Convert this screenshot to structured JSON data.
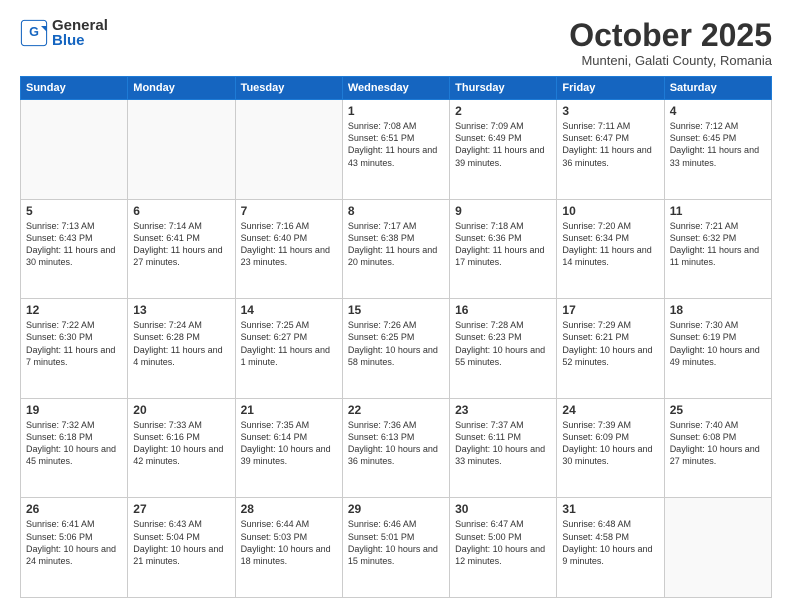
{
  "header": {
    "logo_general": "General",
    "logo_blue": "Blue",
    "month": "October 2025",
    "location": "Munteni, Galati County, Romania"
  },
  "weekdays": [
    "Sunday",
    "Monday",
    "Tuesday",
    "Wednesday",
    "Thursday",
    "Friday",
    "Saturday"
  ],
  "weeks": [
    [
      {
        "day": "",
        "info": ""
      },
      {
        "day": "",
        "info": ""
      },
      {
        "day": "",
        "info": ""
      },
      {
        "day": "1",
        "info": "Sunrise: 7:08 AM\nSunset: 6:51 PM\nDaylight: 11 hours and 43 minutes."
      },
      {
        "day": "2",
        "info": "Sunrise: 7:09 AM\nSunset: 6:49 PM\nDaylight: 11 hours and 39 minutes."
      },
      {
        "day": "3",
        "info": "Sunrise: 7:11 AM\nSunset: 6:47 PM\nDaylight: 11 hours and 36 minutes."
      },
      {
        "day": "4",
        "info": "Sunrise: 7:12 AM\nSunset: 6:45 PM\nDaylight: 11 hours and 33 minutes."
      }
    ],
    [
      {
        "day": "5",
        "info": "Sunrise: 7:13 AM\nSunset: 6:43 PM\nDaylight: 11 hours and 30 minutes."
      },
      {
        "day": "6",
        "info": "Sunrise: 7:14 AM\nSunset: 6:41 PM\nDaylight: 11 hours and 27 minutes."
      },
      {
        "day": "7",
        "info": "Sunrise: 7:16 AM\nSunset: 6:40 PM\nDaylight: 11 hours and 23 minutes."
      },
      {
        "day": "8",
        "info": "Sunrise: 7:17 AM\nSunset: 6:38 PM\nDaylight: 11 hours and 20 minutes."
      },
      {
        "day": "9",
        "info": "Sunrise: 7:18 AM\nSunset: 6:36 PM\nDaylight: 11 hours and 17 minutes."
      },
      {
        "day": "10",
        "info": "Sunrise: 7:20 AM\nSunset: 6:34 PM\nDaylight: 11 hours and 14 minutes."
      },
      {
        "day": "11",
        "info": "Sunrise: 7:21 AM\nSunset: 6:32 PM\nDaylight: 11 hours and 11 minutes."
      }
    ],
    [
      {
        "day": "12",
        "info": "Sunrise: 7:22 AM\nSunset: 6:30 PM\nDaylight: 11 hours and 7 minutes."
      },
      {
        "day": "13",
        "info": "Sunrise: 7:24 AM\nSunset: 6:28 PM\nDaylight: 11 hours and 4 minutes."
      },
      {
        "day": "14",
        "info": "Sunrise: 7:25 AM\nSunset: 6:27 PM\nDaylight: 11 hours and 1 minute."
      },
      {
        "day": "15",
        "info": "Sunrise: 7:26 AM\nSunset: 6:25 PM\nDaylight: 10 hours and 58 minutes."
      },
      {
        "day": "16",
        "info": "Sunrise: 7:28 AM\nSunset: 6:23 PM\nDaylight: 10 hours and 55 minutes."
      },
      {
        "day": "17",
        "info": "Sunrise: 7:29 AM\nSunset: 6:21 PM\nDaylight: 10 hours and 52 minutes."
      },
      {
        "day": "18",
        "info": "Sunrise: 7:30 AM\nSunset: 6:19 PM\nDaylight: 10 hours and 49 minutes."
      }
    ],
    [
      {
        "day": "19",
        "info": "Sunrise: 7:32 AM\nSunset: 6:18 PM\nDaylight: 10 hours and 45 minutes."
      },
      {
        "day": "20",
        "info": "Sunrise: 7:33 AM\nSunset: 6:16 PM\nDaylight: 10 hours and 42 minutes."
      },
      {
        "day": "21",
        "info": "Sunrise: 7:35 AM\nSunset: 6:14 PM\nDaylight: 10 hours and 39 minutes."
      },
      {
        "day": "22",
        "info": "Sunrise: 7:36 AM\nSunset: 6:13 PM\nDaylight: 10 hours and 36 minutes."
      },
      {
        "day": "23",
        "info": "Sunrise: 7:37 AM\nSunset: 6:11 PM\nDaylight: 10 hours and 33 minutes."
      },
      {
        "day": "24",
        "info": "Sunrise: 7:39 AM\nSunset: 6:09 PM\nDaylight: 10 hours and 30 minutes."
      },
      {
        "day": "25",
        "info": "Sunrise: 7:40 AM\nSunset: 6:08 PM\nDaylight: 10 hours and 27 minutes."
      }
    ],
    [
      {
        "day": "26",
        "info": "Sunrise: 6:41 AM\nSunset: 5:06 PM\nDaylight: 10 hours and 24 minutes."
      },
      {
        "day": "27",
        "info": "Sunrise: 6:43 AM\nSunset: 5:04 PM\nDaylight: 10 hours and 21 minutes."
      },
      {
        "day": "28",
        "info": "Sunrise: 6:44 AM\nSunset: 5:03 PM\nDaylight: 10 hours and 18 minutes."
      },
      {
        "day": "29",
        "info": "Sunrise: 6:46 AM\nSunset: 5:01 PM\nDaylight: 10 hours and 15 minutes."
      },
      {
        "day": "30",
        "info": "Sunrise: 6:47 AM\nSunset: 5:00 PM\nDaylight: 10 hours and 12 minutes."
      },
      {
        "day": "31",
        "info": "Sunrise: 6:48 AM\nSunset: 4:58 PM\nDaylight: 10 hours and 9 minutes."
      },
      {
        "day": "",
        "info": ""
      }
    ]
  ]
}
